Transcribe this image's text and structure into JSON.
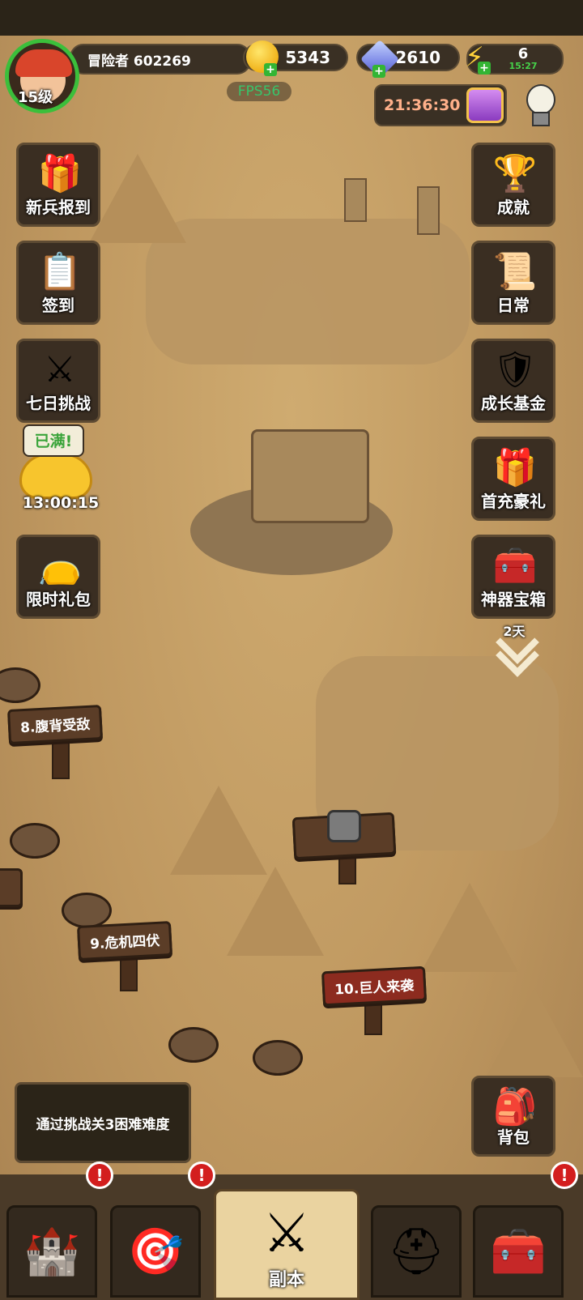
{
  "player": {
    "name": "冒险者 602269",
    "level": "15级"
  },
  "currency": {
    "gold": "5343",
    "gems": "2610",
    "energy": "6",
    "energy_timer": "15:27"
  },
  "fps": "FPS56",
  "event_timer": "21:36:30",
  "left_buttons": [
    {
      "label": "新兵报到",
      "icon": "gift-box-icon"
    },
    {
      "label": "签到",
      "icon": "clipboard-icon"
    },
    {
      "label": "七日挑战",
      "icon": "crossed-swords-icon"
    },
    {
      "label": "限时礼包",
      "icon": "treasure-bag-icon"
    }
  ],
  "piggy": {
    "bubble": "已满!",
    "timer": "13:00:15"
  },
  "right_buttons": [
    {
      "label": "成就",
      "icon": "trophy-icon"
    },
    {
      "label": "日常",
      "icon": "scroll-icon"
    },
    {
      "label": "成长基金",
      "icon": "shield-icon"
    },
    {
      "label": "首充豪礼",
      "icon": "gift-box-icon"
    },
    {
      "label": "神器宝箱",
      "icon": "treasure-chest-icon",
      "sub": "2天"
    },
    {
      "label": "背包",
      "icon": "backpack-icon"
    }
  ],
  "levels": [
    {
      "label": "8.腹背受敌"
    },
    {
      "label": "9.危机四伏"
    },
    {
      "label": "10.巨人来袭"
    }
  ],
  "quest": {
    "text": "通过挑战关3困难难度"
  },
  "bottom_tabs": [
    {
      "icon": "tower-icon",
      "badge": "!"
    },
    {
      "icon": "target-icon",
      "badge": "!"
    },
    {
      "icon": "crossed-swords-icon",
      "label": "副本"
    },
    {
      "icon": "helmet-icon"
    },
    {
      "icon": "treasure-chest-icon",
      "badge": "!"
    }
  ],
  "colors": {
    "accent_green": "#3bbf3b",
    "badge_red": "#d31e1e",
    "fps_green": "#38c46b"
  }
}
